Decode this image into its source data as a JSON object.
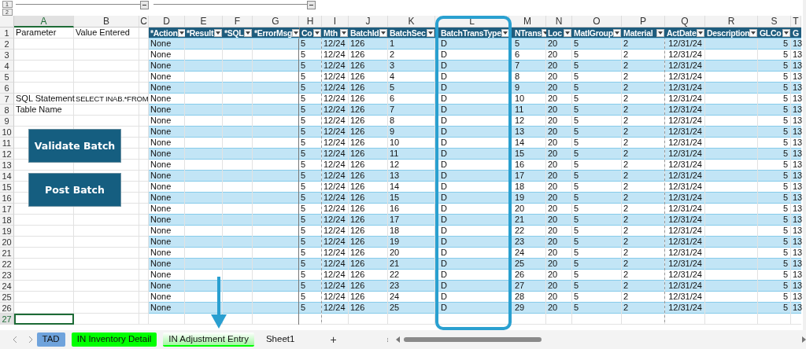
{
  "outline": {
    "levels": [
      "1",
      "2"
    ]
  },
  "column_letters": [
    "A",
    "B",
    "C",
    "D",
    "E",
    "F",
    "G",
    "H",
    "I",
    "J",
    "K",
    "L",
    "M",
    "N",
    "O",
    "P",
    "Q",
    "R",
    "S",
    "T"
  ],
  "row_numbers": [
    "1",
    "2",
    "3",
    "4",
    "5",
    "6",
    "7",
    "8",
    "9",
    "10",
    "11",
    "12",
    "13",
    "14",
    "15",
    "16",
    "17",
    "18",
    "19",
    "20",
    "21",
    "22",
    "23",
    "24",
    "25",
    "26",
    "27"
  ],
  "parameter_header": "Parameter",
  "value_header": "Value Entered",
  "table": {
    "columns": [
      {
        "header": "*Action"
      },
      {
        "header": "*Result"
      },
      {
        "header": "*SQL"
      },
      {
        "header": "*ErrorMsg"
      },
      {
        "header": "Co"
      },
      {
        "header": "Mth"
      },
      {
        "header": "BatchId"
      },
      {
        "header": "BatchSec"
      },
      {
        "header": "BatchTransType"
      },
      {
        "header": "NTrans"
      },
      {
        "header": "Loc"
      },
      {
        "header": "MatlGroup"
      },
      {
        "header": "Material"
      },
      {
        "header": "ActDate"
      },
      {
        "header": "Description"
      },
      {
        "header": "GLCo"
      },
      {
        "header": "G"
      }
    ],
    "rows": [
      {
        "action": "None",
        "co": "5",
        "mth": "12/24",
        "batch_id": "126",
        "batch_seq": "1",
        "batch_trans_type": "D",
        "in_trans": "5",
        "loc": "20",
        "matl_group": "5",
        "material": "2",
        "act_date": "12/31/24",
        "gl_co": "5",
        "column_t": "13"
      },
      {
        "action": "None",
        "co": "5",
        "mth": "12/24",
        "batch_id": "126",
        "batch_seq": "2",
        "batch_trans_type": "D",
        "in_trans": "6",
        "loc": "20",
        "matl_group": "5",
        "material": "2",
        "act_date": "12/31/24",
        "gl_co": "5",
        "column_t": "13"
      },
      {
        "action": "None",
        "co": "5",
        "mth": "12/24",
        "batch_id": "126",
        "batch_seq": "3",
        "batch_trans_type": "D",
        "in_trans": "7",
        "loc": "20",
        "matl_group": "5",
        "material": "2",
        "act_date": "12/31/24",
        "gl_co": "5",
        "column_t": "13"
      },
      {
        "action": "None",
        "co": "5",
        "mth": "12/24",
        "batch_id": "126",
        "batch_seq": "4",
        "batch_trans_type": "D",
        "in_trans": "8",
        "loc": "20",
        "matl_group": "5",
        "material": "2",
        "act_date": "12/31/24",
        "gl_co": "5",
        "column_t": "13"
      },
      {
        "action": "None",
        "co": "5",
        "mth": "12/24",
        "batch_id": "126",
        "batch_seq": "5",
        "batch_trans_type": "D",
        "in_trans": "9",
        "loc": "20",
        "matl_group": "5",
        "material": "2",
        "act_date": "12/31/24",
        "gl_co": "5",
        "column_t": "13"
      },
      {
        "parameter": "SQL Statement",
        "value": "SELECT INAB.*FROM",
        "action": "None",
        "co": "5",
        "mth": "12/24",
        "batch_id": "126",
        "batch_seq": "6",
        "batch_trans_type": "D",
        "in_trans": "10",
        "loc": "20",
        "matl_group": "5",
        "material": "2",
        "act_date": "12/31/24",
        "gl_co": "5",
        "column_t": "13"
      },
      {
        "parameter": "Table Name",
        "action": "None",
        "co": "5",
        "mth": "12/24",
        "batch_id": "126",
        "batch_seq": "7",
        "batch_trans_type": "D",
        "in_trans": "11",
        "loc": "20",
        "matl_group": "5",
        "material": "2",
        "act_date": "12/31/24",
        "gl_co": "5",
        "column_t": "13"
      },
      {
        "action": "None",
        "co": "5",
        "mth": "12/24",
        "batch_id": "126",
        "batch_seq": "8",
        "batch_trans_type": "D",
        "in_trans": "12",
        "loc": "20",
        "matl_group": "5",
        "material": "2",
        "act_date": "12/31/24",
        "gl_co": "5",
        "column_t": "13"
      },
      {
        "action": "None",
        "co": "5",
        "mth": "12/24",
        "batch_id": "126",
        "batch_seq": "9",
        "batch_trans_type": "D",
        "in_trans": "13",
        "loc": "20",
        "matl_group": "5",
        "material": "2",
        "act_date": "12/31/24",
        "gl_co": "5",
        "column_t": "13"
      },
      {
        "action": "None",
        "co": "5",
        "mth": "12/24",
        "batch_id": "126",
        "batch_seq": "10",
        "batch_trans_type": "D",
        "in_trans": "14",
        "loc": "20",
        "matl_group": "5",
        "material": "2",
        "act_date": "12/31/24",
        "gl_co": "5",
        "column_t": "13"
      },
      {
        "action": "None",
        "co": "5",
        "mth": "12/24",
        "batch_id": "126",
        "batch_seq": "11",
        "batch_trans_type": "D",
        "in_trans": "15",
        "loc": "20",
        "matl_group": "5",
        "material": "2",
        "act_date": "12/31/24",
        "gl_co": "5",
        "column_t": "13"
      },
      {
        "action": "None",
        "co": "5",
        "mth": "12/24",
        "batch_id": "126",
        "batch_seq": "12",
        "batch_trans_type": "D",
        "in_trans": "16",
        "loc": "20",
        "matl_group": "5",
        "material": "2",
        "act_date": "12/31/24",
        "gl_co": "5",
        "column_t": "13"
      },
      {
        "action": "None",
        "co": "5",
        "mth": "12/24",
        "batch_id": "126",
        "batch_seq": "13",
        "batch_trans_type": "D",
        "in_trans": "17",
        "loc": "20",
        "matl_group": "5",
        "material": "2",
        "act_date": "12/31/24",
        "gl_co": "5",
        "column_t": "13"
      },
      {
        "action": "None",
        "co": "5",
        "mth": "12/24",
        "batch_id": "126",
        "batch_seq": "14",
        "batch_trans_type": "D",
        "in_trans": "18",
        "loc": "20",
        "matl_group": "5",
        "material": "2",
        "act_date": "12/31/24",
        "gl_co": "5",
        "column_t": "13"
      },
      {
        "action": "None",
        "co": "5",
        "mth": "12/24",
        "batch_id": "126",
        "batch_seq": "15",
        "batch_trans_type": "D",
        "in_trans": "19",
        "loc": "20",
        "matl_group": "5",
        "material": "2",
        "act_date": "12/31/24",
        "gl_co": "5",
        "column_t": "13"
      },
      {
        "action": "None",
        "co": "5",
        "mth": "12/24",
        "batch_id": "126",
        "batch_seq": "16",
        "batch_trans_type": "D",
        "in_trans": "20",
        "loc": "20",
        "matl_group": "5",
        "material": "2",
        "act_date": "12/31/24",
        "gl_co": "5",
        "column_t": "13"
      },
      {
        "action": "None",
        "co": "5",
        "mth": "12/24",
        "batch_id": "126",
        "batch_seq": "17",
        "batch_trans_type": "D",
        "in_trans": "21",
        "loc": "20",
        "matl_group": "5",
        "material": "2",
        "act_date": "12/31/24",
        "gl_co": "5",
        "column_t": "13"
      },
      {
        "action": "None",
        "co": "5",
        "mth": "12/24",
        "batch_id": "126",
        "batch_seq": "18",
        "batch_trans_type": "D",
        "in_trans": "22",
        "loc": "20",
        "matl_group": "5",
        "material": "2",
        "act_date": "12/31/24",
        "gl_co": "5",
        "column_t": "13"
      },
      {
        "action": "None",
        "co": "5",
        "mth": "12/24",
        "batch_id": "126",
        "batch_seq": "19",
        "batch_trans_type": "D",
        "in_trans": "23",
        "loc": "20",
        "matl_group": "5",
        "material": "2",
        "act_date": "12/31/24",
        "gl_co": "5",
        "column_t": "13"
      },
      {
        "action": "None",
        "co": "5",
        "mth": "12/24",
        "batch_id": "126",
        "batch_seq": "20",
        "batch_trans_type": "D",
        "in_trans": "24",
        "loc": "20",
        "matl_group": "5",
        "material": "2",
        "act_date": "12/31/24",
        "gl_co": "5",
        "column_t": "13"
      },
      {
        "action": "None",
        "co": "5",
        "mth": "12/24",
        "batch_id": "126",
        "batch_seq": "21",
        "batch_trans_type": "D",
        "in_trans": "25",
        "loc": "20",
        "matl_group": "5",
        "material": "2",
        "act_date": "12/31/24",
        "gl_co": "5",
        "column_t": "13"
      },
      {
        "action": "None",
        "co": "5",
        "mth": "12/24",
        "batch_id": "126",
        "batch_seq": "22",
        "batch_trans_type": "D",
        "in_trans": "26",
        "loc": "20",
        "matl_group": "5",
        "material": "2",
        "act_date": "12/31/24",
        "gl_co": "5",
        "column_t": "13"
      },
      {
        "action": "None",
        "co": "5",
        "mth": "12/24",
        "batch_id": "126",
        "batch_seq": "23",
        "batch_trans_type": "D",
        "in_trans": "27",
        "loc": "20",
        "matl_group": "5",
        "material": "2",
        "act_date": "12/31/24",
        "gl_co": "5",
        "column_t": "13"
      },
      {
        "action": "None",
        "co": "5",
        "mth": "12/24",
        "batch_id": "126",
        "batch_seq": "24",
        "batch_trans_type": "D",
        "in_trans": "28",
        "loc": "20",
        "matl_group": "5",
        "material": "2",
        "act_date": "12/31/24",
        "gl_co": "5",
        "column_t": "13"
      },
      {
        "action": "None",
        "co": "5",
        "mth": "12/24",
        "batch_id": "126",
        "batch_seq": "25",
        "batch_trans_type": "D",
        "in_trans": "29",
        "loc": "20",
        "matl_group": "5",
        "material": "2",
        "act_date": "12/31/24",
        "gl_co": "5",
        "column_t": "13"
      }
    ]
  },
  "buttons": [
    "Validate Batch",
    "Post Batch"
  ],
  "sheet_tabs": [
    {
      "label": "TAD",
      "selected": false,
      "color": "#6fa3dc"
    },
    {
      "label": "IN Inventory Detail",
      "selected": false,
      "color": "#00ff00"
    },
    {
      "label": "IN Adjustment Entry",
      "selected": true,
      "color": "#00ff00"
    },
    {
      "label": "Sheet1",
      "selected": false
    }
  ],
  "add_sheet": "+"
}
